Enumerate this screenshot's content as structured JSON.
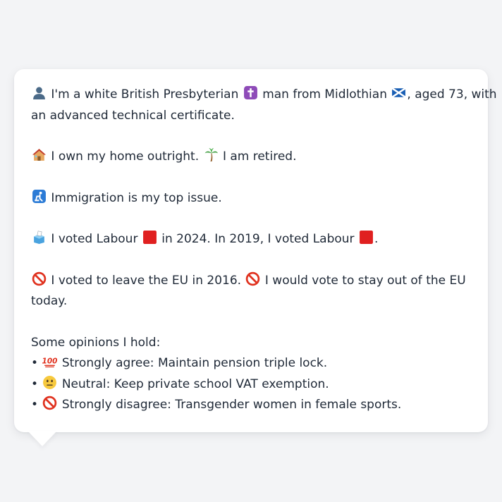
{
  "profile": {
    "intro_part1": "I'm a white British Presbyterian",
    "intro_part2": "man from Midlothian",
    "intro_part3": ", aged 73, with",
    "intro_part4": "an advanced technical certificate.",
    "home_text": "I own my home outright.",
    "retired_text": "I am retired.",
    "issue_text": "Immigration is my top issue.",
    "vote_part1": "I voted Labour",
    "vote_part2": "in 2024. In 2019, I voted Labour",
    "vote_part3": ".",
    "eu_part1": "I voted to leave the EU in 2016.",
    "eu_part2": "I would vote to stay out of the EU",
    "eu_part3": "today.",
    "opinions_heading": "Some opinions I hold:",
    "bullet_char": "•",
    "opinions": [
      {
        "icon": "hundred-points-icon",
        "text": "Strongly agree: Maintain pension triple lock."
      },
      {
        "icon": "neutral-face-icon",
        "text": "Neutral: Keep private school VAT exemption."
      },
      {
        "icon": "no-entry-icon",
        "text": "Strongly disagree: Transgender women in female sports."
      }
    ]
  },
  "colors": {
    "page_background": "#f3f4f6",
    "card_background": "#ffffff",
    "text": "#1f2937",
    "labour_red": "#e02020",
    "no_entry_red": "#e0321f"
  }
}
